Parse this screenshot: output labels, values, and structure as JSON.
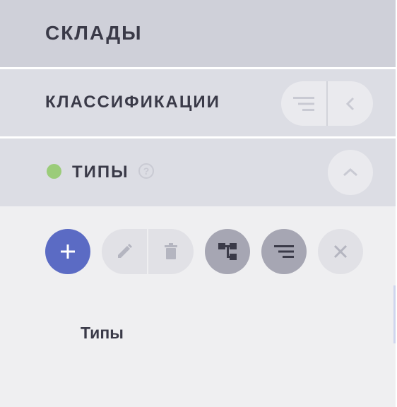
{
  "sections": {
    "warehouses": {
      "title": "СКЛАДЫ"
    },
    "classifications": {
      "title": "КЛАССИФИКАЦИИ"
    },
    "types": {
      "title": "ТИПЫ",
      "help": "?",
      "status_color": "#9bcc79"
    }
  },
  "toolbar": {
    "add_label": "+",
    "buttons": [
      "add",
      "edit",
      "delete",
      "hierarchy",
      "sort",
      "clear"
    ]
  },
  "list": {
    "items": [
      {
        "label": "Типы"
      }
    ]
  },
  "colors": {
    "accent": "#5b6bc4",
    "header_dark": "#cfd0d9",
    "header_light": "#dcdde4",
    "panel": "#efeff1"
  }
}
